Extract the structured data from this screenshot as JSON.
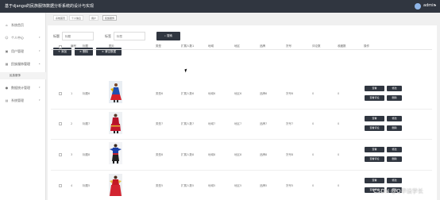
{
  "app": {
    "title": "基于django的民族服饰数据分析系统的设计与实现",
    "user": "admin"
  },
  "sidebar": {
    "items": [
      {
        "label": "系统首页",
        "icon": "home-icon"
      },
      {
        "label": "个人中心",
        "icon": "user-icon"
      },
      {
        "label": "用户管理",
        "icon": "users-icon"
      },
      {
        "label": "民族服饰管理",
        "icon": "grid-icon",
        "active": true
      },
      {
        "label": "数据统计管理",
        "icon": "pin-icon"
      },
      {
        "label": "系统管理",
        "icon": "settings-icon"
      }
    ],
    "subitem": "民族服饰"
  },
  "breadcrumbs": [
    "系统首页",
    "个人信息",
    "用户",
    "民族服饰"
  ],
  "search": {
    "label1": "标题",
    "placeholder1": "标题",
    "label2": "标签",
    "placeholder2": "标签",
    "button": "搜索"
  },
  "toolbar": {
    "add": "添加",
    "delete": "删除",
    "clear": "清空数据"
  },
  "table": {
    "headers": [
      "编号",
      "标题",
      "图片",
      "类型",
      "扩展人数1",
      "地域",
      "地区",
      "品牌",
      "货号",
      "评论数",
      "收藏数",
      "操作"
    ],
    "rows": [
      {
        "id": "1",
        "title": "标题6",
        "type": "类型6",
        "people": "扩展人数6",
        "region": "地域6",
        "area": "地区6",
        "brand": "品牌6",
        "sku": "货号6",
        "comments": "0",
        "favs": "0"
      },
      {
        "id": "2",
        "title": "标题7",
        "type": "类型7",
        "people": "扩展人数7",
        "region": "地域7",
        "area": "地区7",
        "brand": "品牌7",
        "sku": "货号7",
        "comments": "0",
        "favs": "0"
      },
      {
        "id": "3",
        "title": "标题8",
        "type": "类型8",
        "people": "扩展人数8",
        "region": "地域8",
        "area": "地区8",
        "brand": "品牌8",
        "sku": "货号8",
        "comments": "0",
        "favs": "0"
      },
      {
        "id": "4",
        "title": "标题5",
        "type": "类型5",
        "people": "扩展人数5",
        "region": "地域5",
        "area": "地区5",
        "brand": "品牌5",
        "sku": "货号5",
        "comments": "0",
        "favs": "0"
      }
    ],
    "actions": {
      "view": "查看",
      "edit": "修改",
      "comment": "查看评论",
      "delete": "删除"
    }
  },
  "watermark": "CSDN @Q毕设学长"
}
